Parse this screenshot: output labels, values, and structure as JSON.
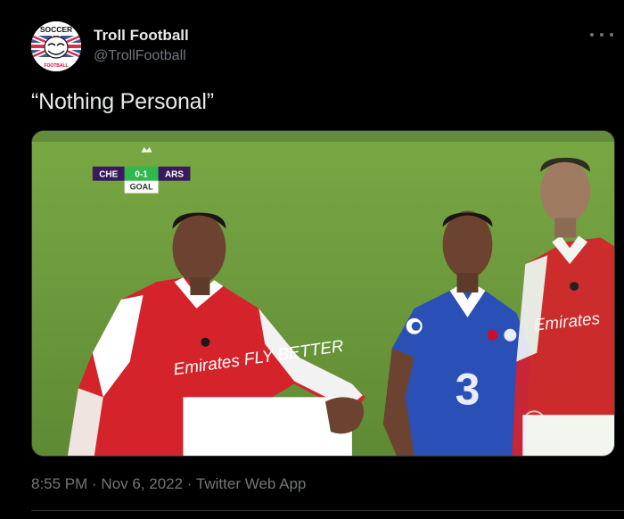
{
  "author": {
    "display_name": "Troll Football",
    "handle": "@TrollFootball",
    "avatar_text_top": "SOCCER",
    "avatar_text_bottom": "FOOTBALL"
  },
  "tweet": {
    "text": "“Nothing Personal”"
  },
  "media": {
    "scoreboard": {
      "home": "CHE",
      "score": "0-1",
      "away": "ARS",
      "event": "GOAL"
    },
    "shirt_sponsor": "Emirates FLY BETTER",
    "colors": {
      "pitch": "#6d9a3c",
      "arsenal_red": "#d4232b",
      "chelsea_blue": "#2a50b8"
    }
  },
  "meta": {
    "time": "8:55 PM",
    "separator": " · ",
    "date": "Nov 6, 2022",
    "source": "Twitter Web App"
  },
  "icons": {
    "more": "more-horizontal-icon",
    "avatar": "troll-face-logo"
  }
}
